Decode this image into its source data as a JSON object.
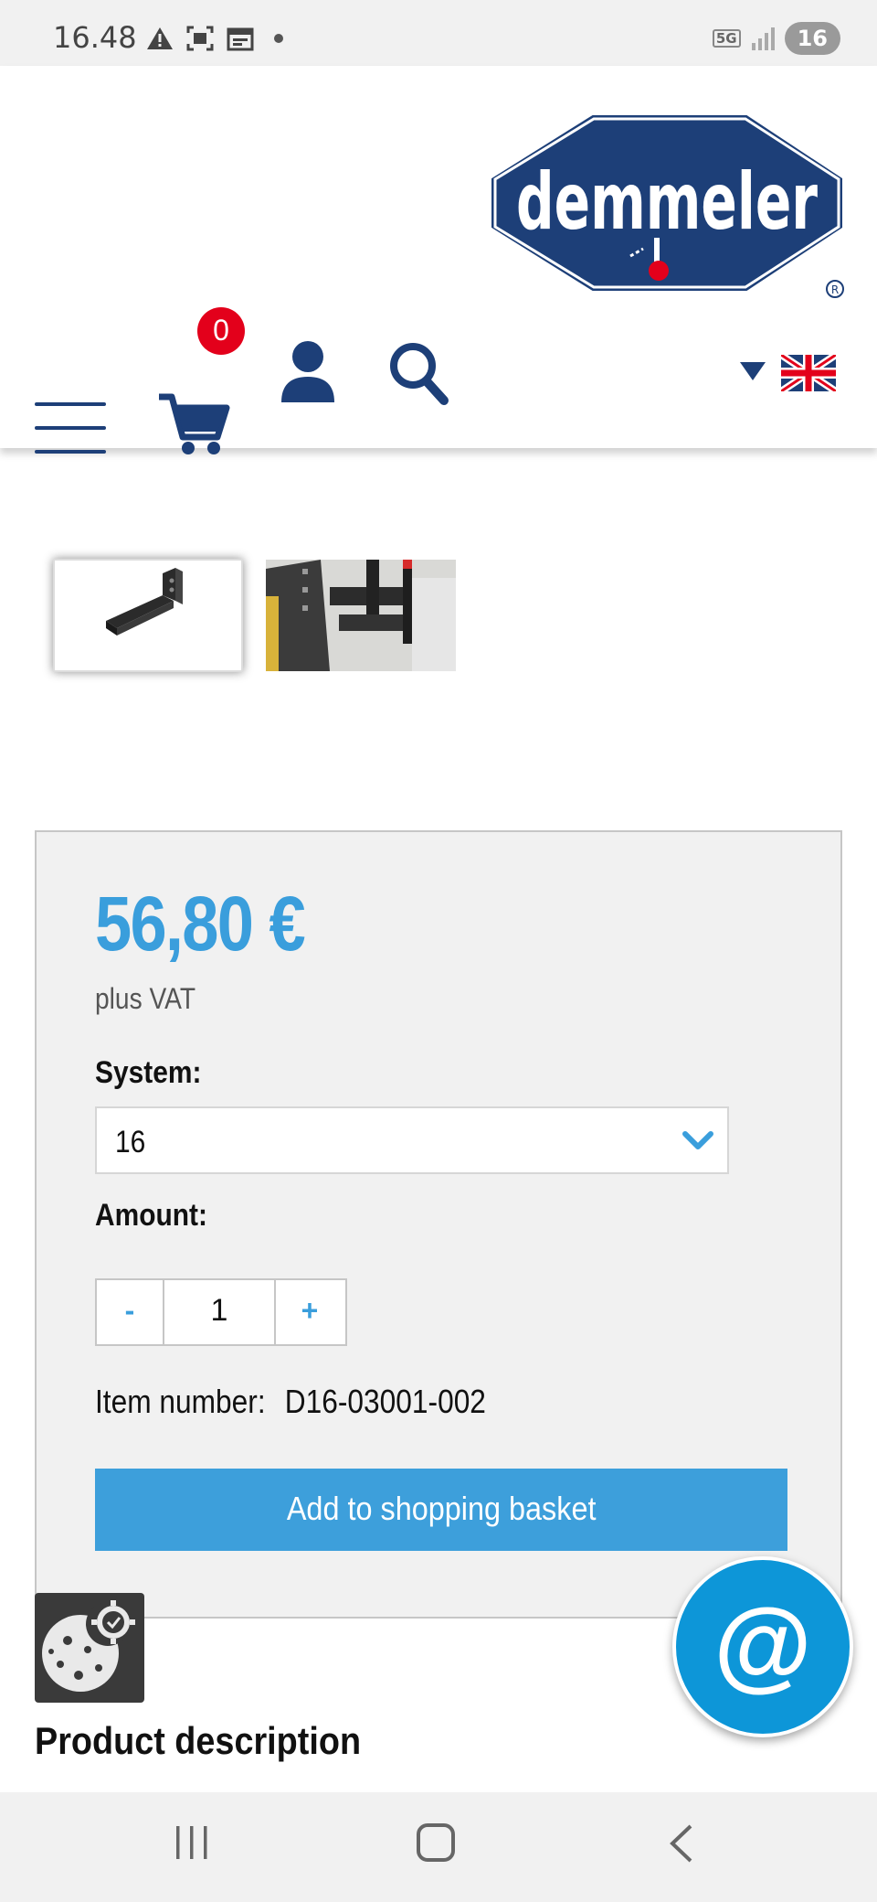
{
  "status_bar": {
    "time": "16.48",
    "network": "5G",
    "battery": "16",
    "icons": [
      "warning-icon",
      "screenshot-icon",
      "calendar-icon",
      "notification-dot-icon",
      "signal-icon"
    ]
  },
  "header": {
    "logo_text": "demmeler",
    "cart_count": "0",
    "icons": [
      "menu-icon",
      "cart-icon",
      "account-icon",
      "search-icon",
      "dropdown-triangle-icon",
      "uk-flag-icon"
    ]
  },
  "purchase": {
    "price": "56,80 €",
    "vat_note": "plus VAT",
    "system_label": "System:",
    "system_value": "16",
    "amount_label": "Amount:",
    "minus": "-",
    "quantity": "1",
    "plus": "+",
    "item_number_label": "Item number:",
    "item_number": "D16-03001-002",
    "add_button": "Add to shopping basket"
  },
  "contact_button": "@",
  "product_description_title": "Product description",
  "colors": {
    "brand_blue": "#1d3f78",
    "accent_blue": "#3a9edc",
    "badge_red": "#e3001b",
    "contact_blue": "#0d96d8"
  }
}
